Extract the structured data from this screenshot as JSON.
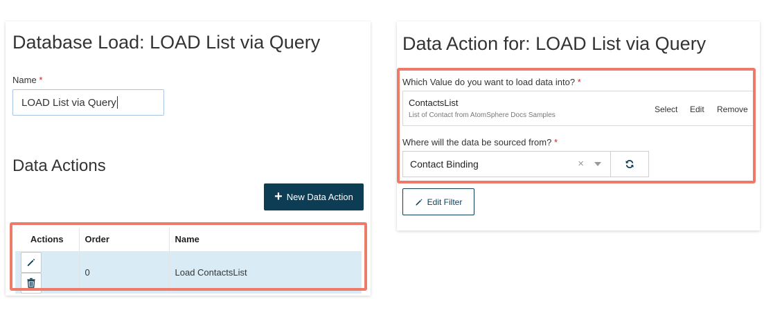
{
  "left_panel": {
    "title": "Database Load: LOAD List via Query",
    "name_label": "Name",
    "required_mark": "*",
    "name_value": "LOAD List via Query",
    "section_title": "Data Actions",
    "new_action_label": "New Data Action",
    "table": {
      "headers": [
        "Actions",
        "Order",
        "Name"
      ],
      "rows": [
        {
          "order": "0",
          "name": "Load ContactsList"
        }
      ]
    }
  },
  "right_panel": {
    "title": "Data Action for: LOAD List via Query",
    "value_label": "Which Value do you want to load data into?",
    "required_mark": "*",
    "value_name": "ContactsList",
    "value_description": "List of Contact from AtomSphere Docs Samples",
    "links": {
      "select": "Select",
      "edit": "Edit",
      "remove": "Remove"
    },
    "source_label": "Where will the data be sourced from?",
    "source_value": "Contact Binding",
    "clear_symbol": "×",
    "edit_filter_label": "Edit Filter"
  },
  "icons": [
    "plus-icon",
    "pencil-icon",
    "trash-icon",
    "refresh-icon",
    "chevron-down-icon",
    "clear-icon"
  ],
  "colors": {
    "primary": "#0d3d55",
    "highlight": "#ee7b69",
    "row_selected": "#d9ecf5",
    "required": "#cc1f1f"
  }
}
